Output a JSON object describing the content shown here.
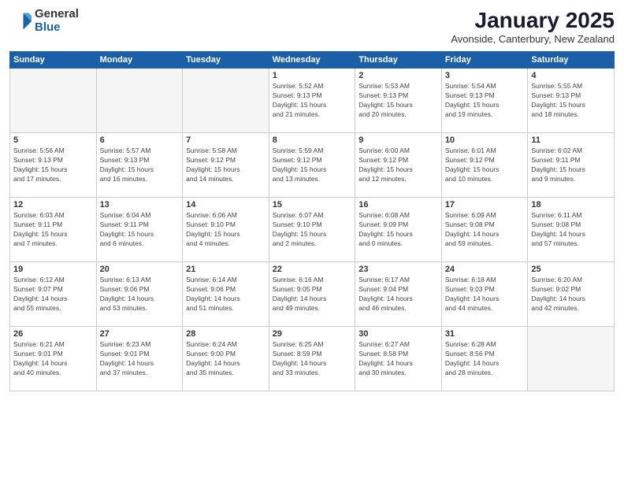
{
  "header": {
    "logo_general": "General",
    "logo_blue": "Blue",
    "title": "January 2025",
    "subtitle": "Avonside, Canterbury, New Zealand"
  },
  "weekdays": [
    "Sunday",
    "Monday",
    "Tuesday",
    "Wednesday",
    "Thursday",
    "Friday",
    "Saturday"
  ],
  "weeks": [
    [
      {
        "day": "",
        "info": ""
      },
      {
        "day": "",
        "info": ""
      },
      {
        "day": "",
        "info": ""
      },
      {
        "day": "1",
        "info": "Sunrise: 5:52 AM\nSunset: 9:13 PM\nDaylight: 15 hours\nand 21 minutes."
      },
      {
        "day": "2",
        "info": "Sunrise: 5:53 AM\nSunset: 9:13 PM\nDaylight: 15 hours\nand 20 minutes."
      },
      {
        "day": "3",
        "info": "Sunrise: 5:54 AM\nSunset: 9:13 PM\nDaylight: 15 hours\nand 19 minutes."
      },
      {
        "day": "4",
        "info": "Sunrise: 5:55 AM\nSunset: 9:13 PM\nDaylight: 15 hours\nand 18 minutes."
      }
    ],
    [
      {
        "day": "5",
        "info": "Sunrise: 5:56 AM\nSunset: 9:13 PM\nDaylight: 15 hours\nand 17 minutes."
      },
      {
        "day": "6",
        "info": "Sunrise: 5:57 AM\nSunset: 9:13 PM\nDaylight: 15 hours\nand 16 minutes."
      },
      {
        "day": "7",
        "info": "Sunrise: 5:58 AM\nSunset: 9:12 PM\nDaylight: 15 hours\nand 14 minutes."
      },
      {
        "day": "8",
        "info": "Sunrise: 5:59 AM\nSunset: 9:12 PM\nDaylight: 15 hours\nand 13 minutes."
      },
      {
        "day": "9",
        "info": "Sunrise: 6:00 AM\nSunset: 9:12 PM\nDaylight: 15 hours\nand 12 minutes."
      },
      {
        "day": "10",
        "info": "Sunrise: 6:01 AM\nSunset: 9:12 PM\nDaylight: 15 hours\nand 10 minutes."
      },
      {
        "day": "11",
        "info": "Sunrise: 6:02 AM\nSunset: 9:11 PM\nDaylight: 15 hours\nand 9 minutes."
      }
    ],
    [
      {
        "day": "12",
        "info": "Sunrise: 6:03 AM\nSunset: 9:11 PM\nDaylight: 15 hours\nand 7 minutes."
      },
      {
        "day": "13",
        "info": "Sunrise: 6:04 AM\nSunset: 9:11 PM\nDaylight: 15 hours\nand 6 minutes."
      },
      {
        "day": "14",
        "info": "Sunrise: 6:06 AM\nSunset: 9:10 PM\nDaylight: 15 hours\nand 4 minutes."
      },
      {
        "day": "15",
        "info": "Sunrise: 6:07 AM\nSunset: 9:10 PM\nDaylight: 15 hours\nand 2 minutes."
      },
      {
        "day": "16",
        "info": "Sunrise: 6:08 AM\nSunset: 9:09 PM\nDaylight: 15 hours\nand 0 minutes."
      },
      {
        "day": "17",
        "info": "Sunrise: 6:09 AM\nSunset: 9:08 PM\nDaylight: 14 hours\nand 59 minutes."
      },
      {
        "day": "18",
        "info": "Sunrise: 6:11 AM\nSunset: 9:08 PM\nDaylight: 14 hours\nand 57 minutes."
      }
    ],
    [
      {
        "day": "19",
        "info": "Sunrise: 6:12 AM\nSunset: 9:07 PM\nDaylight: 14 hours\nand 55 minutes."
      },
      {
        "day": "20",
        "info": "Sunrise: 6:13 AM\nSunset: 9:06 PM\nDaylight: 14 hours\nand 53 minutes."
      },
      {
        "day": "21",
        "info": "Sunrise: 6:14 AM\nSunset: 9:06 PM\nDaylight: 14 hours\nand 51 minutes."
      },
      {
        "day": "22",
        "info": "Sunrise: 6:16 AM\nSunset: 9:05 PM\nDaylight: 14 hours\nand 49 minutes."
      },
      {
        "day": "23",
        "info": "Sunrise: 6:17 AM\nSunset: 9:04 PM\nDaylight: 14 hours\nand 46 minutes."
      },
      {
        "day": "24",
        "info": "Sunrise: 6:18 AM\nSunset: 9:03 PM\nDaylight: 14 hours\nand 44 minutes."
      },
      {
        "day": "25",
        "info": "Sunrise: 6:20 AM\nSunset: 9:02 PM\nDaylight: 14 hours\nand 42 minutes."
      }
    ],
    [
      {
        "day": "26",
        "info": "Sunrise: 6:21 AM\nSunset: 9:01 PM\nDaylight: 14 hours\nand 40 minutes."
      },
      {
        "day": "27",
        "info": "Sunrise: 6:23 AM\nSunset: 9:01 PM\nDaylight: 14 hours\nand 37 minutes."
      },
      {
        "day": "28",
        "info": "Sunrise: 6:24 AM\nSunset: 9:00 PM\nDaylight: 14 hours\nand 35 minutes."
      },
      {
        "day": "29",
        "info": "Sunrise: 6:25 AM\nSunset: 8:59 PM\nDaylight: 14 hours\nand 33 minutes."
      },
      {
        "day": "30",
        "info": "Sunrise: 6:27 AM\nSunset: 8:58 PM\nDaylight: 14 hours\nand 30 minutes."
      },
      {
        "day": "31",
        "info": "Sunrise: 6:28 AM\nSunset: 8:56 PM\nDaylight: 14 hours\nand 28 minutes."
      },
      {
        "day": "",
        "info": ""
      }
    ]
  ]
}
